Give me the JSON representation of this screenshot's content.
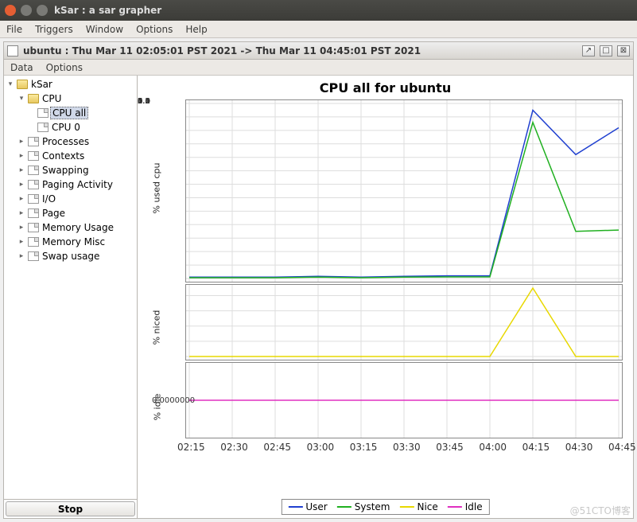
{
  "window": {
    "title": "kSar : a sar grapher"
  },
  "menubar": [
    "File",
    "Triggers",
    "Window",
    "Options",
    "Help"
  ],
  "subwindow": {
    "title": "ubuntu : Thu Mar 11 02:05:01 PST 2021 -> Thu Mar 11 04:45:01 PST 2021"
  },
  "submenu": [
    "Data",
    "Options"
  ],
  "tree": {
    "root": "kSar",
    "cpu": {
      "label": "CPU",
      "children": [
        "CPU all",
        "CPU 0"
      ]
    },
    "items": [
      "Processes",
      "Contexts",
      "Swapping",
      "Paging Activity",
      "I/O",
      "Page",
      "Memory Usage",
      "Memory Misc",
      "Swap usage"
    ]
  },
  "stop_label": "Stop",
  "chart_title": "CPU all for ubuntu",
  "axis_labels": {
    "used": "% used cpu",
    "niced": "% niced",
    "idle": "% idle"
  },
  "idle_tick": "0.0000000",
  "legend": [
    "User",
    "System",
    "Nice",
    "Idle"
  ],
  "legend_colors": {
    "User": "#2040d0",
    "System": "#20b020",
    "Nice": "#e8d800",
    "Idle": "#e030c0"
  },
  "watermark": "@51CTO博客",
  "chart_data": [
    {
      "type": "line",
      "title": "% used cpu",
      "x": [
        "02:15",
        "02:30",
        "02:45",
        "03:00",
        "03:15",
        "03:30",
        "03:45",
        "04:00",
        "04:15",
        "04:30",
        "04:45"
      ],
      "ylim": [
        0,
        6.5
      ],
      "yticks": [
        0.0,
        0.5,
        1.0,
        1.5,
        2.0,
        2.5,
        3.0,
        3.5,
        4.0,
        4.5,
        5.0,
        5.5,
        6.0,
        6.5
      ],
      "series": [
        {
          "name": "User",
          "color": "#2040d0",
          "values": [
            0.05,
            0.05,
            0.05,
            0.08,
            0.05,
            0.08,
            0.1,
            0.1,
            6.25,
            4.6,
            5.6
          ]
        },
        {
          "name": "System",
          "color": "#20b020",
          "values": [
            0.03,
            0.03,
            0.03,
            0.05,
            0.03,
            0.05,
            0.06,
            0.06,
            5.8,
            1.75,
            1.8
          ]
        }
      ]
    },
    {
      "type": "line",
      "title": "% niced",
      "x": [
        "02:15",
        "02:30",
        "02:45",
        "03:00",
        "03:15",
        "03:30",
        "03:45",
        "04:00",
        "04:15",
        "04:30",
        "04:45"
      ],
      "ylim": [
        0,
        0.45
      ],
      "yticks": [
        0.0,
        0.1,
        0.2,
        0.3,
        0.4
      ],
      "series": [
        {
          "name": "Nice",
          "color": "#e8d800",
          "values": [
            0,
            0,
            0,
            0,
            0,
            0,
            0,
            0,
            0.45,
            0,
            0
          ]
        }
      ]
    },
    {
      "type": "line",
      "title": "% idle",
      "x": [
        "02:15",
        "02:30",
        "02:45",
        "03:00",
        "03:15",
        "03:30",
        "03:45",
        "04:00",
        "04:15",
        "04:30",
        "04:45"
      ],
      "ylim": [
        -0.01,
        0.01
      ],
      "series": [
        {
          "name": "Idle",
          "color": "#e030c0",
          "values": [
            0,
            0,
            0,
            0,
            0,
            0,
            0,
            0,
            0,
            0,
            0
          ]
        }
      ]
    }
  ]
}
